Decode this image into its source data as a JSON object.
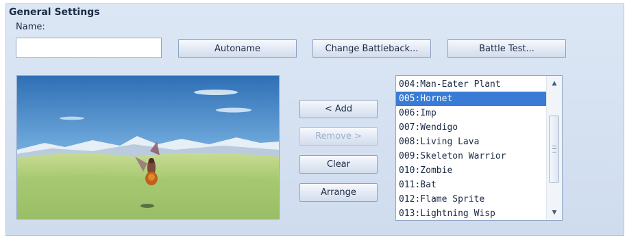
{
  "section": {
    "title": "General Settings"
  },
  "name_field": {
    "label": "Name:",
    "value": "",
    "placeholder": ""
  },
  "buttons": {
    "autoname": "Autoname",
    "change_battleback": "Change Battleback...",
    "battle_test": "Battle Test...",
    "add": "< Add",
    "remove": "Remove >",
    "clear": "Clear",
    "arrange": "Arrange"
  },
  "enemy_list": {
    "items": [
      "004:Man-Eater Plant",
      "005:Hornet",
      "006:Imp",
      "007:Wendigo",
      "008:Living Lava",
      "009:Skeleton Warrior",
      "010:Zombie",
      "011:Bat",
      "012:Flame Sprite",
      "013:Lightning Wisp"
    ],
    "selected": "005:Hornet"
  },
  "preview": {
    "subject": "hornet-enemy-sprite",
    "background": "grassland-battleback"
  },
  "colors": {
    "selection": "#3a7bd5",
    "panel": "#d6e2f2"
  },
  "icons": {
    "scroll_up": "scroll-up-arrow-icon",
    "scroll_down": "scroll-down-arrow-icon"
  }
}
